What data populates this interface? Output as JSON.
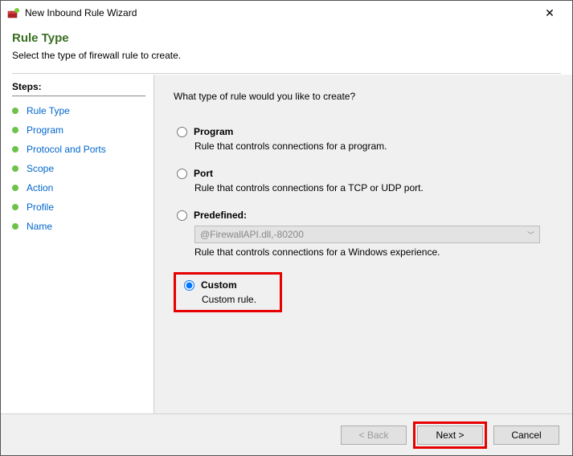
{
  "window": {
    "title": "New Inbound Rule Wizard",
    "close_glyph": "✕"
  },
  "header": {
    "title": "Rule Type",
    "subtitle": "Select the type of firewall rule to create."
  },
  "sidebar": {
    "steps_label": "Steps:",
    "items": [
      {
        "label": "Rule Type"
      },
      {
        "label": "Program"
      },
      {
        "label": "Protocol and Ports"
      },
      {
        "label": "Scope"
      },
      {
        "label": "Action"
      },
      {
        "label": "Profile"
      },
      {
        "label": "Name"
      }
    ]
  },
  "main": {
    "question": "What type of rule would you like to create?",
    "options": {
      "program": {
        "label": "Program",
        "desc": "Rule that controls connections for a program."
      },
      "port": {
        "label": "Port",
        "desc": "Rule that controls connections for a TCP or UDP port."
      },
      "predefined": {
        "label": "Predefined:",
        "select_value": "@FirewallAPI.dll,-80200",
        "desc": "Rule that controls connections for a Windows experience."
      },
      "custom": {
        "label": "Custom",
        "desc": "Custom rule."
      }
    }
  },
  "footer": {
    "back": "< Back",
    "next": "Next >",
    "cancel": "Cancel"
  }
}
